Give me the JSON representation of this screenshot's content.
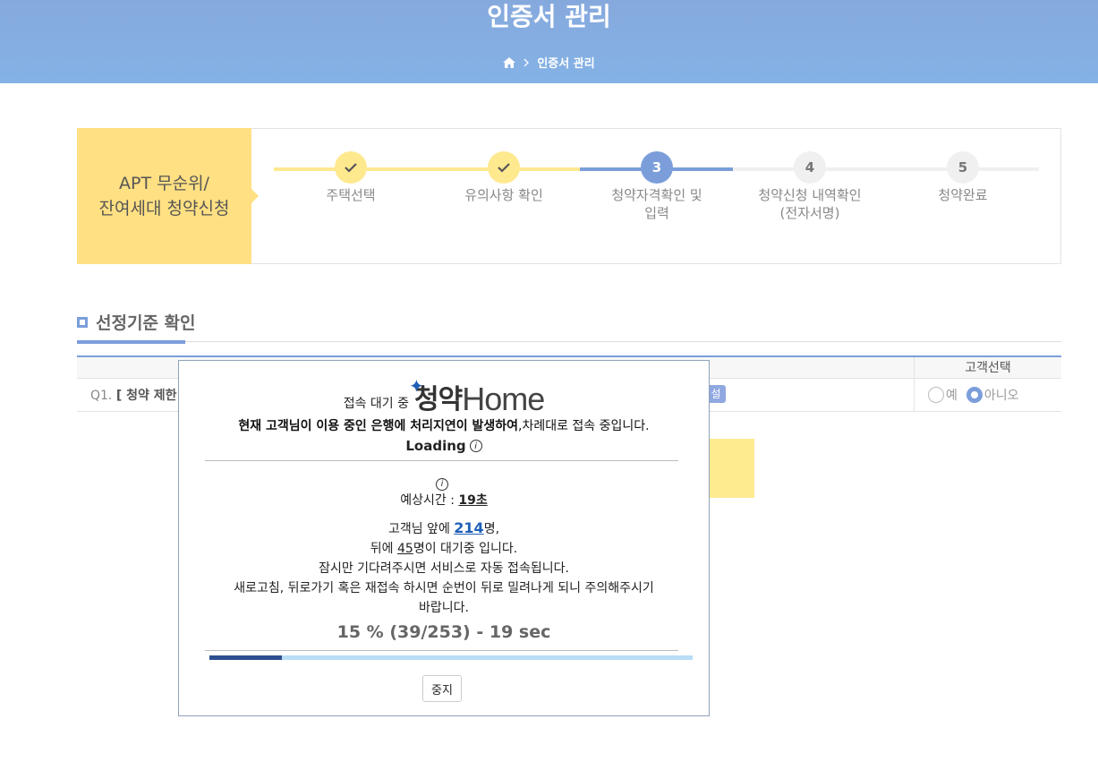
{
  "header": {
    "title": "인증서 관리",
    "breadcrumb": "인증서 관리"
  },
  "steps": {
    "label_line1": "APT 무순위/",
    "label_line2": "잔여세대 청약신청",
    "items": [
      {
        "number": "",
        "label_line1": "주택선택",
        "label_line2": "",
        "state": "done"
      },
      {
        "number": "",
        "label_line1": "유의사항 확인",
        "label_line2": "",
        "state": "done"
      },
      {
        "number": "3",
        "label_line1": "청약자격확인 및",
        "label_line2": "입력",
        "state": "current"
      },
      {
        "number": "4",
        "label_line1": "청약신청 내역확인",
        "label_line2": "(전자서명)",
        "state": "todo"
      },
      {
        "number": "5",
        "label_line1": "청약완료",
        "label_line2": "",
        "state": "todo"
      }
    ]
  },
  "section": {
    "title": "선정기준 확인"
  },
  "table": {
    "header_customer": "고객선택",
    "row": {
      "question_no": "Q1.",
      "question_text": "[ 청약 제한",
      "badge": "설명",
      "option_yes": "예",
      "option_no": "아니오",
      "selected": "아니오"
    }
  },
  "modal": {
    "waiting_label": "접속 대기 중",
    "logo_ko": "청약",
    "logo_en": "Home",
    "message_bold": "현재 고객님이 이용 중인 은행에 처리지연이 발생하여",
    "message_rest": ",차례대로 접속 중입니다.",
    "loading": "Loading",
    "estimate_label": "예상시간 : ",
    "estimate_value": "19초",
    "line1_pre": "고객님 앞에 ",
    "ahead_count": "214",
    "line1_post": "명,",
    "line2_pre": "뒤에 ",
    "behind_count": "45",
    "line2_post": "명이 대기중 입니다.",
    "line3": "잠시만 기다려주시면 서비스로 자동 접속됩니다.",
    "line4": "새로고침, 뒤로가기 혹은 재접속 하시면 순번이 뒤로 밀려나게 되니 주의해주시기",
    "line5": "바랍니다.",
    "progress_text": "15 % (39/253) - 19 sec",
    "progress_fraction": 0.15,
    "stop_button": "중지"
  },
  "colors": {
    "header_bg": "#84ade2",
    "accent_blue": "#7b9edb",
    "step_yellow": "#ffe083",
    "progress_fill": "#2d4f8f",
    "progress_track": "#b8dcf5"
  }
}
